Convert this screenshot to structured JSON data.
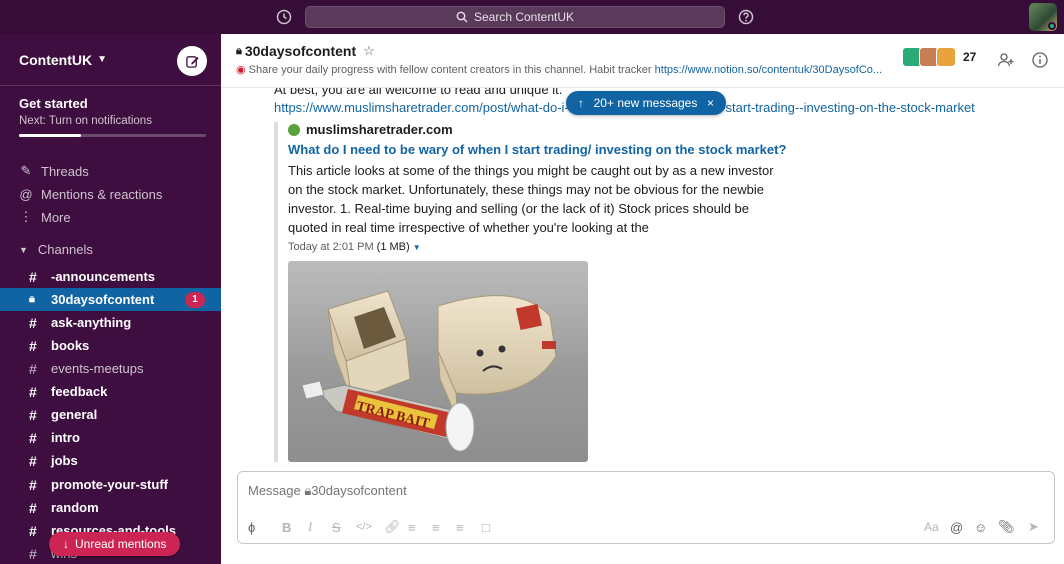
{
  "topbar": {
    "search_label": "Search ContentUK",
    "history_icon": "history-icon",
    "help_icon": "help-icon",
    "status_color": "#2bac76"
  },
  "sidebar": {
    "workspace_name": "ContentUK",
    "workspace_caret": "⌄",
    "get_started_title": "Get started",
    "get_started_sub": "Next: Turn on notifications",
    "get_started_progress": 0.33,
    "nav": [
      {
        "label": "Threads",
        "icon": "threads-icon"
      },
      {
        "label": "Mentions & reactions",
        "icon": "at-icon"
      },
      {
        "label": "More",
        "icon": "more-icon"
      }
    ],
    "channels_header": "Channels",
    "channels": [
      {
        "name": "-announcements",
        "bold": true
      },
      {
        "name": "30daysofcontent",
        "active": true,
        "badge": "1"
      },
      {
        "name": "ask-anything",
        "bold": true
      },
      {
        "name": "books",
        "bold": true
      },
      {
        "name": "events-meetups",
        "bold": false
      },
      {
        "name": "feedback",
        "bold": true
      },
      {
        "name": "general",
        "bold": true
      },
      {
        "name": "intro",
        "bold": true
      },
      {
        "name": "jobs",
        "bold": true
      },
      {
        "name": "promote-your-stuff",
        "bold": true
      },
      {
        "name": "random",
        "bold": true
      },
      {
        "name": "resources-and-tools",
        "bold": true
      },
      {
        "name": "wins",
        "bold": false
      }
    ],
    "unread_mentions": "Unread mentions",
    "active_color": "#1164a3",
    "badge_color": "#cd2553"
  },
  "channel": {
    "name": "30daysofcontent",
    "topic_prefix": "Share your daily progress with fellow content creators in this channel. Habit tracker ",
    "topic_link": "https://www.notion.so/contentuk/30DaysofCo...",
    "member_count": "27"
  },
  "messages": {
    "cut_text": "At best, you are all welcome to read and unique it.",
    "link": "https://www.muslimsharetrader.com/post/what-do-i-need-to-be-wary-of-when-i-start-trading--investing-on-the-stock-market",
    "new_messages": "20+ new messages",
    "unfurl": {
      "site": "muslimsharetrader.com",
      "title": "What do I need to be wary of when I start trading/ investing on the stock market?",
      "description": "This article looks at some of the things you might be caught out by as a new investor on the stock market. Unfortunately, these things may not be obvious for the newbie investor. 1. Real-time buying and selling (or the lack of it) Stock prices should be quoted in real time irrespective of whether you're looking at the",
      "meta_time": "Today at 2:01 PM",
      "meta_size": "(1 MB)",
      "image_text": "TRAP BAIT"
    }
  },
  "composer": {
    "placeholder": "Message 🔒︎30daysofcontent",
    "format_label": "Aa"
  }
}
